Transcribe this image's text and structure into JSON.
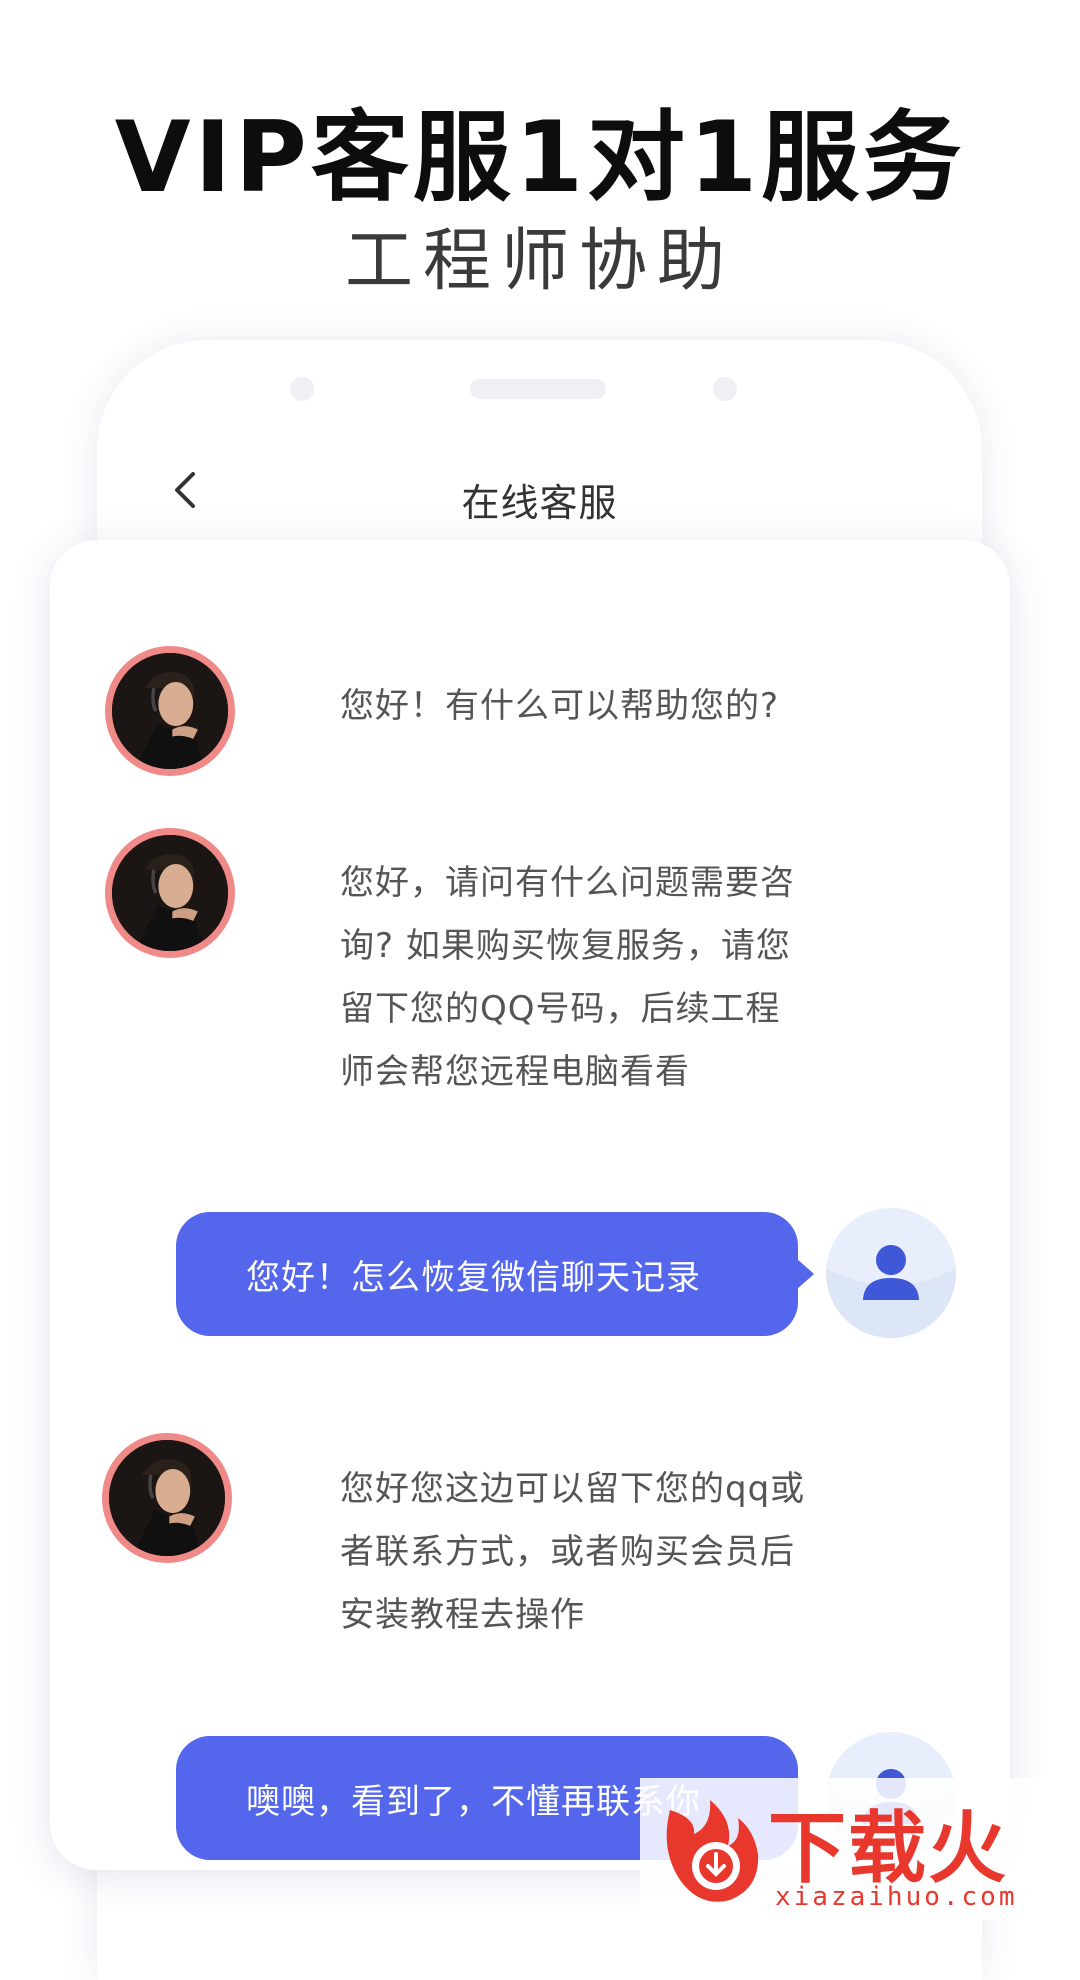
{
  "header": {
    "title": "VIP客服1对1服务",
    "subtitle": "工程师协助"
  },
  "nav": {
    "back_icon": "chevron-left-icon",
    "title": "在线客服"
  },
  "messages": [
    {
      "from": "agent",
      "lines": [
        "您好！有什么可以帮助您的?"
      ]
    },
    {
      "from": "agent",
      "lines": [
        "您好，请问有什么问题需要咨",
        "询? 如果购买恢复服务，请您",
        "留下您的QQ号码，后续工程",
        "师会帮您远程电脑看看"
      ]
    },
    {
      "from": "user",
      "text": "您好！怎么恢复微信聊天记录"
    },
    {
      "from": "agent",
      "lines": [
        "您好您这边可以留下您的qq或",
        "者联系方式，或者购买会员后",
        "安装教程去操作"
      ]
    },
    {
      "from": "user",
      "text": "噢噢，看到了，不懂再联系你"
    }
  ],
  "colors": {
    "accent": "#5366ec",
    "avatar_ring": "#f08a89",
    "watermark": "#e8382e"
  },
  "watermark": {
    "brand": "下载火",
    "url": "xiazaihuo.com"
  }
}
